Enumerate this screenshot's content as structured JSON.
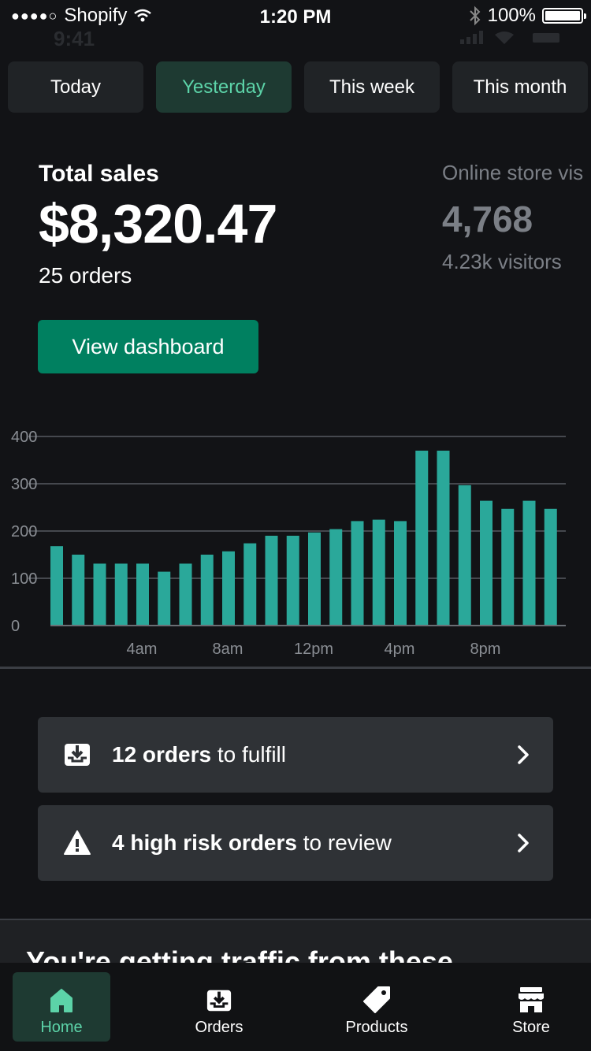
{
  "status_bar": {
    "carrier": "Shopify",
    "time": "1:20 PM",
    "battery": "100%",
    "ghost_time": "9:41"
  },
  "period_tabs": [
    {
      "label": "Today",
      "active": false
    },
    {
      "label": "Yesterday",
      "active": true
    },
    {
      "label": "This week",
      "active": false
    },
    {
      "label": "This month",
      "active": false
    }
  ],
  "sales": {
    "title": "Total sales",
    "amount": "$8,320.47",
    "orders": "25 orders"
  },
  "visitors": {
    "title": "Online store vis",
    "count": "4,768",
    "sub": "4.23k visitors"
  },
  "dashboard_button": "View dashboard",
  "chart_data": {
    "type": "bar",
    "ylim": [
      0,
      400
    ],
    "yticks": [
      0,
      100,
      200,
      300,
      400
    ],
    "xtick_labels": [
      "4am",
      "8am",
      "12pm",
      "4pm",
      "8pm"
    ],
    "values": [
      168,
      150,
      131,
      131,
      131,
      114,
      131,
      150,
      157,
      174,
      190,
      190,
      197,
      204,
      221,
      224,
      221,
      370,
      370,
      297,
      264,
      247,
      264,
      247
    ],
    "bar_color": "#2aa89a",
    "grid": true
  },
  "cards": [
    {
      "bold": "12 orders",
      "rest": " to fulfill",
      "icon": "inbox-download-icon"
    },
    {
      "bold": "4 high risk orders",
      "rest": " to review",
      "icon": "warning-icon"
    }
  ],
  "traffic": {
    "title": "You're getting traffic from these",
    "more": "•••"
  },
  "tab_bar": [
    {
      "label": "Home",
      "icon": "home-icon",
      "active": true
    },
    {
      "label": "Orders",
      "icon": "orders-icon",
      "active": false
    },
    {
      "label": "Products",
      "icon": "tag-icon",
      "active": false
    },
    {
      "label": "Store",
      "icon": "store-icon",
      "active": false
    }
  ],
  "colors": {
    "accent": "#008060",
    "active_text": "#5cd3a8",
    "background": "#121316"
  }
}
